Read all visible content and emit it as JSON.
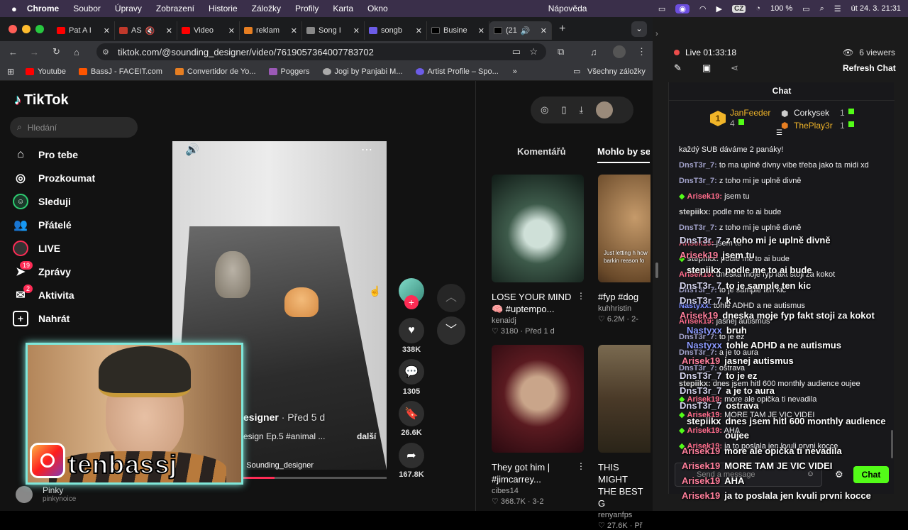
{
  "menubar": {
    "app": "Chrome",
    "items": [
      "Soubor",
      "Úpravy",
      "Zobrazení",
      "Historie",
      "Záložky",
      "Profily",
      "Karta",
      "Okno",
      "Nápověda"
    ],
    "battery": "100 %",
    "lang": "CZ",
    "clock": "út 24. 3. 21:31"
  },
  "tabs": [
    {
      "label": "Pat A I",
      "color": "#ff0000"
    },
    {
      "label": "AS",
      "color": "#c0392b"
    },
    {
      "label": "Video",
      "color": "#ff0000"
    },
    {
      "label": "reklam",
      "color": "#e67e22"
    },
    {
      "label": "Song I",
      "color": "#888888"
    },
    {
      "label": "songb",
      "color": "#6c5ce7"
    },
    {
      "label": "Busine",
      "color": "#222222"
    },
    {
      "label": "(21",
      "color": "#222222"
    }
  ],
  "url": "tiktok.com/@sounding_designer/video/7619057364007783702",
  "bookmarks": [
    {
      "label": "Youtube",
      "color": "#ff0000"
    },
    {
      "label": "BassJ - FACEIT.com",
      "color": "#ff5500"
    },
    {
      "label": "Convertidor de Yo...",
      "color": "#e67e22"
    },
    {
      "label": "Poggers",
      "color": "#9b59b6"
    },
    {
      "label": "Jogi by Panjabi M...",
      "color": "#aaaaaa"
    },
    {
      "label": "Artist Profile – Spo...",
      "color": "#6c5ce7"
    }
  ],
  "bookmarks_all": "Všechny záložky",
  "tiktok": {
    "logo": "TikTok",
    "search_placeholder": "Hledání",
    "nav": [
      {
        "label": "Pro tebe",
        "icon": "home-icon"
      },
      {
        "label": "Prozkoumat",
        "icon": "compass-icon"
      },
      {
        "label": "Sleduji",
        "icon": "following-icon"
      },
      {
        "label": "Přátelé",
        "icon": "friends-icon"
      },
      {
        "label": "LIVE",
        "icon": "live-icon"
      },
      {
        "label": "Zprávy",
        "icon": "messages-icon",
        "badge": "19"
      },
      {
        "label": "Aktivita",
        "icon": "activity-icon",
        "badge": "2"
      },
      {
        "label": "Nahrát",
        "icon": "upload-icon"
      }
    ],
    "video": {
      "author_suffix": "esigner",
      "posted": "· Před 5 d",
      "caption": "esign Ep.5 #animal ...",
      "more": "další",
      "sound": "Sounding_designer"
    },
    "actions": [
      {
        "icon": "heart-icon",
        "count": "338K"
      },
      {
        "icon": "comment-icon",
        "count": "1305"
      },
      {
        "icon": "bookmark-icon",
        "count": "26.6K"
      },
      {
        "icon": "share-icon",
        "count": "167.8K"
      }
    ],
    "tabs": [
      "Komentářů",
      "Mohlo by se"
    ],
    "following_user": "Pinky",
    "following_handle": "pinkynoice",
    "cards": [
      {
        "title1": "LOSE YOUR MIND",
        "title2": "🧠 #uptempo...",
        "author": "kenaidj",
        "stats": "♡ 3180 · Před 1 d",
        "bg": "#20302a"
      },
      {
        "title1": "#fyp #dog",
        "title2": "",
        "author": "kuhhristin",
        "stats": "♡ 6.2M · 2-",
        "bg": "#7a5a3a",
        "overlay": "Just letting h how barkin reason fo"
      },
      {
        "title1": "They got him |",
        "title2": "#jimcarrey...",
        "author": "cibes14",
        "stats": "♡ 368.7K · 3-2",
        "bg": "#3a0f14"
      },
      {
        "title1": "THIS MIGHT",
        "title2": "THE BEST G",
        "author": "renyanfps",
        "stats": "♡ 27.6K · Př",
        "bg": "#4a4030"
      }
    ]
  },
  "stream": {
    "live_time": "Live 01:33:18",
    "viewers": "6 viewers",
    "refresh": "Refresh Chat",
    "chat_header": "Chat",
    "leaders": [
      {
        "rank": "1",
        "name": "JanFeeder",
        "count": "4"
      },
      {
        "name": "Corkysek",
        "count": "1"
      },
      {
        "name": "ThePlay3r",
        "count": "1"
      }
    ],
    "chat": [
      {
        "user": "",
        "text": "každý SUB dáváme 2 panáky!",
        "color": "#efeff1"
      },
      {
        "user": "DnsT3r_7:",
        "text": "to ma uplně divny vibe třeba jako ta midi xd",
        "color": "#a0a0c8"
      },
      {
        "user": "DnsT3r_7:",
        "text": "z toho mi je uplně divně",
        "color": "#a0a0c8"
      },
      {
        "user": "Arisek19:",
        "text": "jsem tu",
        "color": "#ff6b8a",
        "badge": true
      },
      {
        "user": "stepiikx:",
        "text": "podle me to ai bude",
        "color": "#d0d0d0"
      },
      {
        "user": "DnsT3r_7:",
        "text": "z toho mi je uplně divně",
        "color": "#a0a0c8"
      },
      {
        "user": "Arisek19:",
        "text": "jsem tu",
        "color": "#ff6b8a"
      },
      {
        "user": "stepiikx:",
        "text": "podle me to ai bude",
        "color": "#d0d0d0",
        "badge": true
      },
      {
        "user": "Arisek19:",
        "text": "dneska moje fyp fakt stoji za kokot",
        "color": "#ff6b8a"
      },
      {
        "user": "DnsT3r_7:",
        "text": "to je sample ten kic",
        "color": "#a0a0c8"
      },
      {
        "user": "Nastyxx:",
        "text": "tohle ADHD a ne autismus",
        "color": "#7b8cff"
      },
      {
        "user": "Arisek19:",
        "text": "jasnej autismus",
        "color": "#ff6b8a"
      },
      {
        "user": "DnsT3r_7:",
        "text": "to je ez",
        "color": "#a0a0c8"
      },
      {
        "user": "DnsT3r_7:",
        "text": "a je to aura",
        "color": "#a0a0c8"
      },
      {
        "user": "DnsT3r_7:",
        "text": "ostrava",
        "color": "#a0a0c8"
      },
      {
        "user": "stepiikx:",
        "text": "dnes jsem hitl 600 monthly audience oujee",
        "color": "#d0d0d0"
      },
      {
        "user": "Arisek19:",
        "text": "more ale opička ti nevadila",
        "color": "#ff6b8a",
        "badge": true
      },
      {
        "user": "Arisek19:",
        "text": "MORE TAM JE VIC VIDEI",
        "color": "#ff6b8a",
        "badge": true
      },
      {
        "user": "Arisek19:",
        "text": "AHA",
        "color": "#ff6b8a",
        "badge": true
      },
      {
        "user": "Arisek19:",
        "text": "ja to poslala jen kvuli prvni kocce",
        "color": "#ff6b8a",
        "badge": true
      }
    ],
    "send_placeholder": "Send a message",
    "chat_button": "Chat"
  },
  "overlay": {
    "brand": "tenbassj",
    "chat": [
      {
        "n": "DnsT3r_7",
        "t": "z toho mi je uplně divně",
        "c": "#d6d6f0"
      },
      {
        "n": "Arisek19",
        "t": "jsem tu",
        "c": "#ff7f9c"
      },
      {
        "n": "stepiikx",
        "t": "podle me to ai bude",
        "c": "#ffffff"
      },
      {
        "n": "DnsT3r_7",
        "t": "to je sample ten kic",
        "c": "#d6d6f0"
      },
      {
        "n": "DnsT3r_7",
        "t": "k",
        "c": "#d6d6f0"
      },
      {
        "n": "Arisek19",
        "t": "dneska moje fyp fakt stoji za kokot",
        "c": "#ff7f9c"
      },
      {
        "n": "Nastyxx",
        "t": "bruh",
        "c": "#8d9bff"
      },
      {
        "n": "Nastyxx",
        "t": "tohle ADHD a ne autismus",
        "c": "#8d9bff"
      },
      {
        "n": "Arisek19",
        "t": "jasnej autismus",
        "c": "#ff7f9c"
      },
      {
        "n": "DnsT3r_7",
        "t": "to je ez",
        "c": "#d6d6f0"
      },
      {
        "n": "DnsT3r_7",
        "t": "a je to aura",
        "c": "#d6d6f0"
      },
      {
        "n": "DnsT3r_7",
        "t": "ostrava",
        "c": "#d6d6f0"
      },
      {
        "n": "stepiikx",
        "t": "dnes jsem hitl 600 monthly audience",
        "c": "#ffffff"
      },
      {
        "n": "",
        "t": "oujee",
        "c": "#ffffff"
      },
      {
        "n": "Arisek19",
        "t": "more ale opička ti nevadila",
        "c": "#ff7f9c"
      },
      {
        "n": "Arisek19",
        "t": "MORE TAM JE VIC VIDEI",
        "c": "#ff7f9c"
      },
      {
        "n": "Arisek19",
        "t": "AHA",
        "c": "#ff7f9c"
      },
      {
        "n": "Arisek19",
        "t": "ja to poslala jen kvuli prvni kocce",
        "c": "#ff7f9c"
      }
    ]
  }
}
